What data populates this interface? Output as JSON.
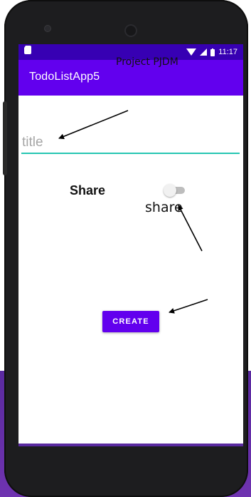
{
  "statusbar": {
    "time": "11:17"
  },
  "app": {
    "title": "TodoListApp5"
  },
  "form": {
    "title_placeholder": "title",
    "share_label": "Share",
    "share_switch_on": false,
    "create_button": "CREATE"
  },
  "annotations": {
    "project": "Project PJDM",
    "share": "share"
  },
  "colors": {
    "statusbar": "#3700b3",
    "appbar": "#6200ee",
    "input_underline": "#26c6b2",
    "button": "#6200ee"
  }
}
